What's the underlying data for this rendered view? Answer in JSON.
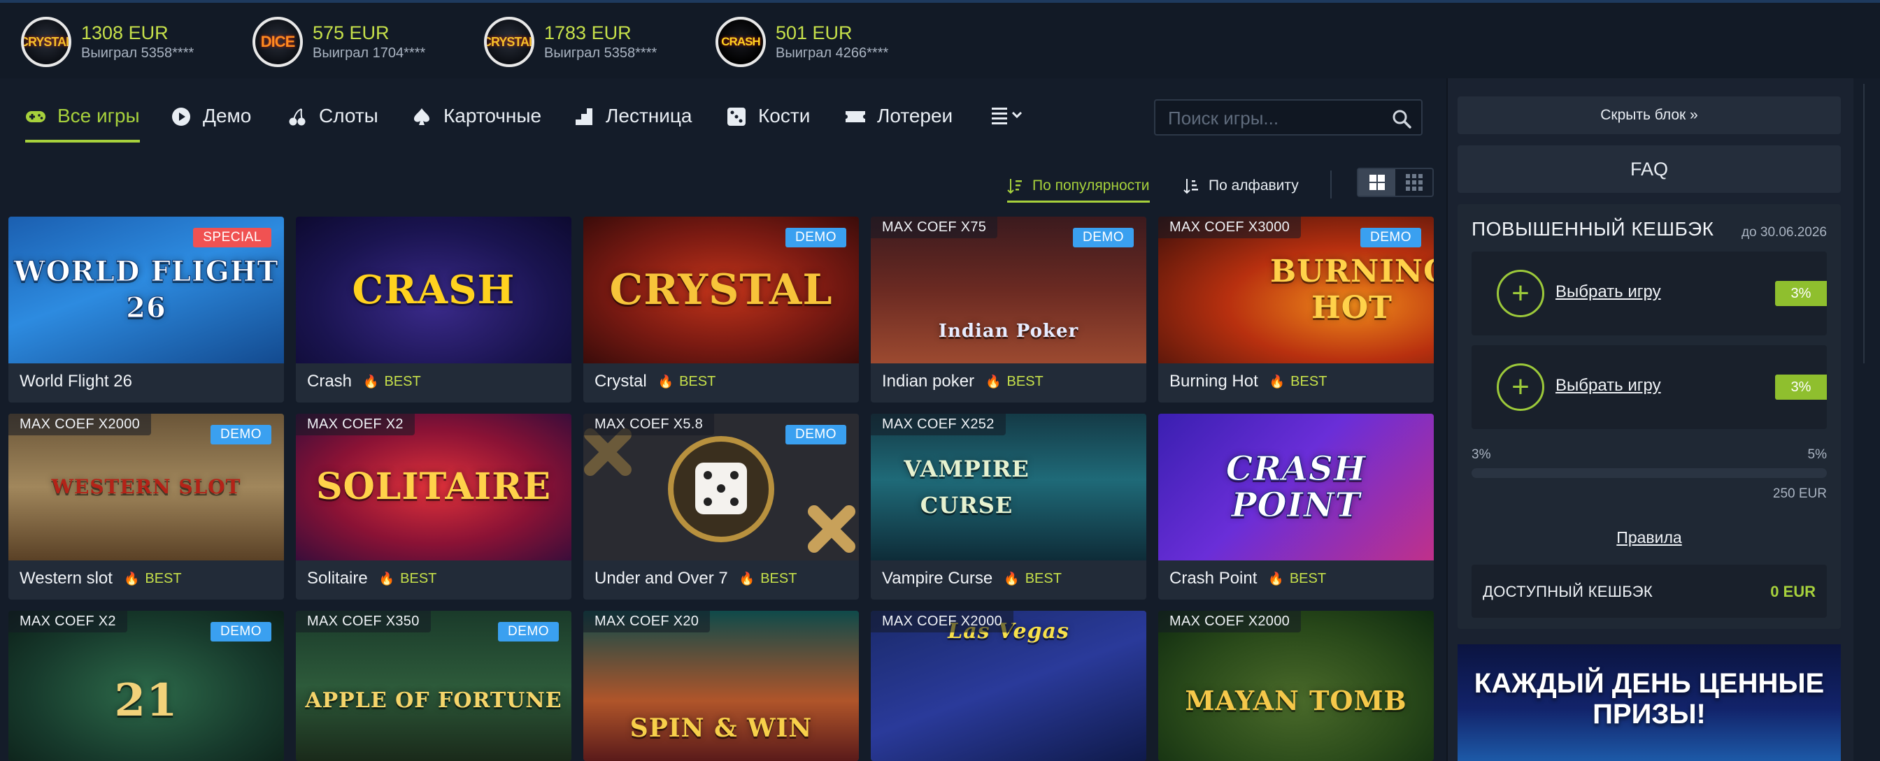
{
  "winners": [
    {
      "game": "CRYSTAL",
      "amount": "1308 EUR",
      "who": "Выиграл 5358****"
    },
    {
      "game": "DICE",
      "amount": "575 EUR",
      "who": "Выиграл 1704****"
    },
    {
      "game": "CRYSTAL",
      "amount": "1783 EUR",
      "who": "Выиграл 5358****"
    },
    {
      "game": "CRASH",
      "amount": "501 EUR",
      "who": "Выиграл 4266****"
    }
  ],
  "nav": {
    "items": [
      {
        "label": "Все игры",
        "icon": "gamepad-icon"
      },
      {
        "label": "Демо",
        "icon": "play-icon"
      },
      {
        "label": "Слоты",
        "icon": "cherry-icon"
      },
      {
        "label": "Карточные",
        "icon": "spade-icon"
      },
      {
        "label": "Лестница",
        "icon": "stairs-icon"
      },
      {
        "label": "Кости",
        "icon": "dice-icon"
      },
      {
        "label": "Лотереи",
        "icon": "ticket-icon"
      }
    ],
    "active": "Все игры"
  },
  "search": {
    "placeholder": "Поиск игры..."
  },
  "sort": {
    "popular": "По популярности",
    "alpha": "По алфавиту",
    "active": "По популярности",
    "view": "large-grid"
  },
  "games": [
    {
      "title": "World Flight 26",
      "art": "WORLD FLIGHT 26",
      "badge": "SPECIAL",
      "best": false,
      "maxcoef": ""
    },
    {
      "title": "Crash",
      "art": "CRASH",
      "badge": "",
      "best": true,
      "maxcoef": ""
    },
    {
      "title": "Crystal",
      "art": "CRYSTAL",
      "badge": "DEMO",
      "best": true,
      "maxcoef": ""
    },
    {
      "title": "Indian poker",
      "art": "Indian Poker",
      "badge": "DEMO",
      "best": true,
      "maxcoef": "MAX COEF X75"
    },
    {
      "title": "Burning Hot",
      "art": "BURNING HOT",
      "badge": "DEMO",
      "best": true,
      "maxcoef": "MAX COEF X3000"
    },
    {
      "title": "Western slot",
      "art": "WESTERN SLOT",
      "badge": "DEMO",
      "best": true,
      "maxcoef": "MAX COEF X2000"
    },
    {
      "title": "Solitaire",
      "art": "SOLITAIRE",
      "badge": "",
      "best": true,
      "maxcoef": "MAX COEF X2"
    },
    {
      "title": "Under and Over 7",
      "art": "",
      "badge": "DEMO",
      "best": true,
      "maxcoef": "MAX COEF X5.8"
    },
    {
      "title": "Vampire Curse",
      "art": "VAMPIRE CURSE",
      "badge": "",
      "best": true,
      "maxcoef": "MAX COEF X252"
    },
    {
      "title": "Crash Point",
      "art": "CRASH POINT",
      "badge": "",
      "best": true,
      "maxcoef": ""
    },
    {
      "title": "",
      "art": "21",
      "badge": "DEMO",
      "best": false,
      "maxcoef": "MAX COEF X2"
    },
    {
      "title": "",
      "art": "APPLE OF FORTUNE",
      "badge": "DEMO",
      "best": false,
      "maxcoef": "MAX COEF X350"
    },
    {
      "title": "",
      "art": "SPIN & WIN",
      "badge": "",
      "best": false,
      "maxcoef": "MAX COEF X20"
    },
    {
      "title": "",
      "art": "Las Vegas",
      "badge": "",
      "best": false,
      "maxcoef": "MAX COEF X2000"
    },
    {
      "title": "",
      "art": "MAYAN TOMB",
      "badge": "",
      "best": false,
      "maxcoef": "MAX COEF X2000"
    }
  ],
  "best_label": "BEST",
  "sidebar": {
    "hide_label": "Скрыть блок »",
    "faq_label": "FAQ",
    "cashback": {
      "title": "ПОВЫШЕННЫЙ КЕШБЭК",
      "until": "до 30.06.2026",
      "slots": [
        {
          "link": "Выбрать игру",
          "pct": "3%"
        },
        {
          "link": "Выбрать игру",
          "pct": "3%"
        }
      ],
      "scale_min": "3%",
      "scale_max": "5%",
      "progress": 0,
      "target": "250 EUR",
      "rules": "Правила",
      "available_label": "ДОСТУПНЫЙ КЕШБЭК",
      "available_value": "0 EUR"
    },
    "promo": "КАЖДЫЙ ДЕНЬ ЦЕННЫЕ ПРИЗЫ!"
  },
  "colors": {
    "accent": "#a7d13c",
    "demo": "#3aa0f0",
    "special": "#f05252",
    "bg": "#141c29"
  }
}
